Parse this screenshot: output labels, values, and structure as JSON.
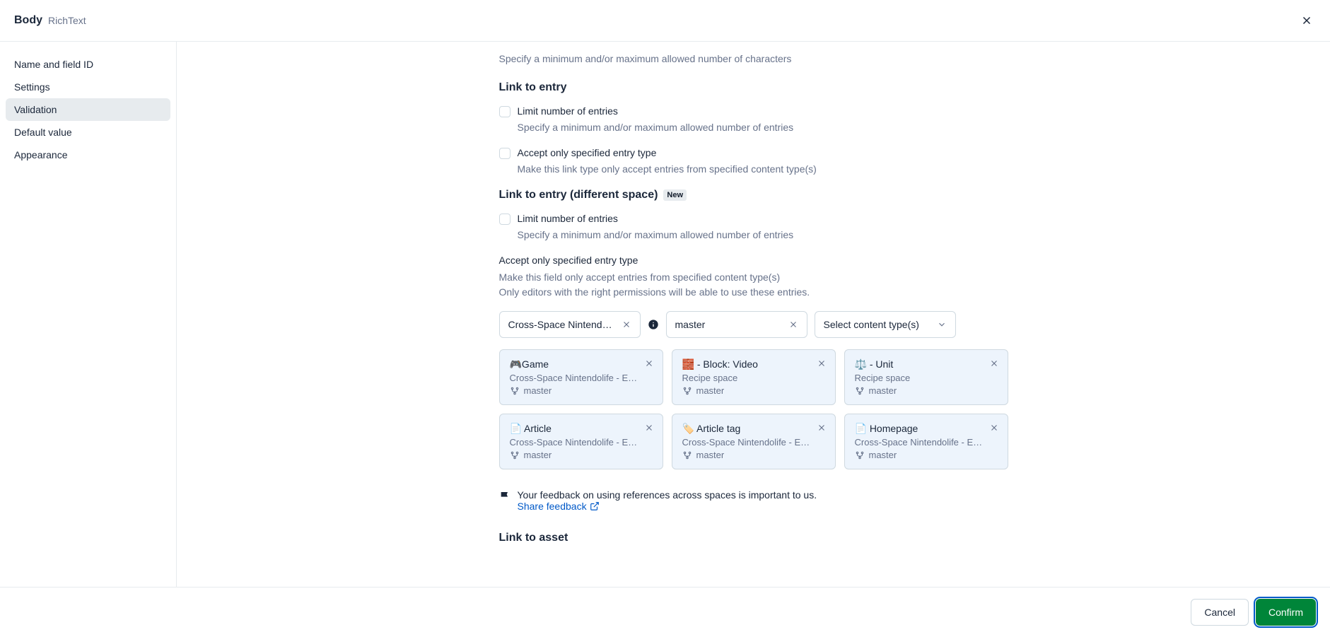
{
  "header": {
    "title": "Body",
    "subtitle": "RichText"
  },
  "sidebar": {
    "items": [
      {
        "label": "Name and field ID",
        "active": false
      },
      {
        "label": "Settings",
        "active": false
      },
      {
        "label": "Validation",
        "active": true
      },
      {
        "label": "Default value",
        "active": false
      },
      {
        "label": "Appearance",
        "active": false
      }
    ]
  },
  "content": {
    "top_helper": "Specify a minimum and/or maximum allowed number of characters",
    "sections": {
      "link_to_entry": {
        "title": "Link to entry",
        "limit_label": "Limit number of entries",
        "limit_helper": "Specify a minimum and/or maximum allowed number of entries",
        "accept_label": "Accept only specified entry type",
        "accept_helper": "Make this link type only accept entries from specified content type(s)"
      },
      "link_to_entry_diff": {
        "title": "Link to entry (different space)",
        "badge": "New",
        "limit_label": "Limit number of entries",
        "limit_helper": "Specify a minimum and/or maximum allowed number of entries",
        "accept_title": "Accept only specified entry type",
        "accept_line1": "Make this field only accept entries from specified content type(s)",
        "accept_line2": "Only editors with the right permissions will be able to use these entries.",
        "filter_space": "Cross-Space Nintendolife …",
        "filter_env": "master",
        "filter_select": "Select content type(s)",
        "chips": [
          {
            "emoji": "🎮",
            "title": "Game",
            "subtitle": "Cross-Space Nintendolife - E…",
            "env": "master"
          },
          {
            "emoji": "🧱",
            "title": " - Block: Video",
            "subtitle": "Recipe space",
            "env": "master"
          },
          {
            "emoji": "⚖️",
            "title": " - Unit",
            "subtitle": "Recipe space",
            "env": "master"
          },
          {
            "emoji": "📄",
            "title": " Article",
            "subtitle": "Cross-Space Nintendolife - E…",
            "env": "master"
          },
          {
            "emoji": "🏷️",
            "title": " Article tag",
            "subtitle": "Cross-Space Nintendolife - E…",
            "env": "master"
          },
          {
            "emoji": "📄",
            "title": " Homepage",
            "subtitle": "Cross-Space Nintendolife - E…",
            "env": "master"
          }
        ],
        "feedback_text": "Your feedback on using references across spaces is important to us.",
        "feedback_link": "Share feedback"
      },
      "link_to_asset": {
        "title": "Link to asset"
      }
    }
  },
  "footer": {
    "cancel": "Cancel",
    "confirm": "Confirm"
  }
}
